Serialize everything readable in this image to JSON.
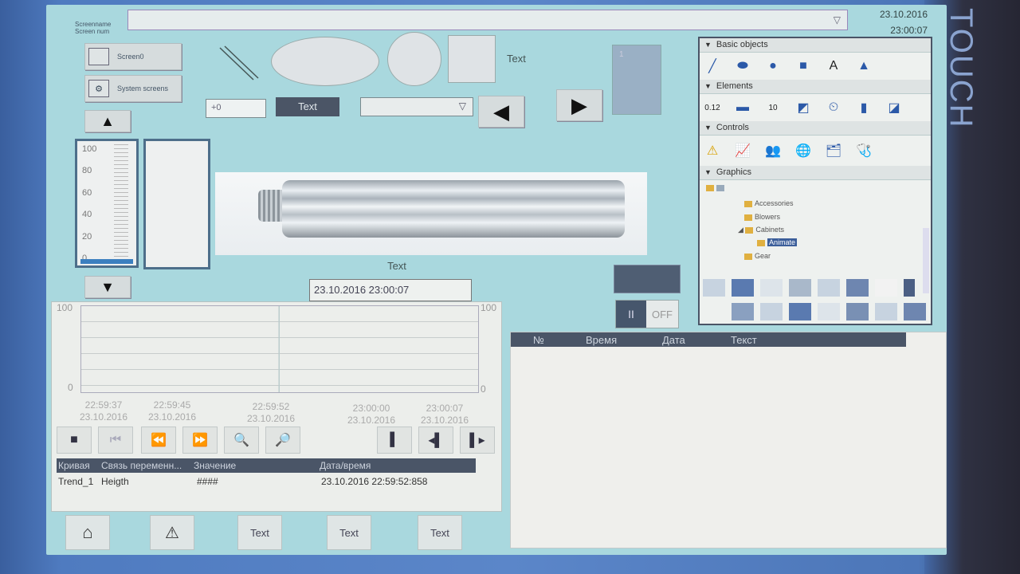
{
  "header": {
    "label_line1": "Screenname",
    "label_line2": "Screen num",
    "date": "23.10.2016",
    "time": "23:00:07"
  },
  "brand": "TOUCH",
  "screen_buttons": [
    {
      "label": "Screen0",
      "icon": "screen-icon"
    },
    {
      "label": "System screens",
      "icon": "system-icon"
    }
  ],
  "shapes": {
    "text_label": "Text"
  },
  "io_field": {
    "value": "+0"
  },
  "text_button": {
    "label": "Text"
  },
  "slider": {
    "value": "1"
  },
  "gauge": {
    "ticks": [
      "100",
      "80",
      "60",
      "40",
      "20",
      "0"
    ],
    "level": 0
  },
  "image_caption": "Text",
  "date_time_field": "23.10.2016 23:00:07",
  "toggle": {
    "on_label": "II",
    "off_label": "OFF"
  },
  "trend": {
    "y_left_max": "100",
    "y_left_min": "0",
    "y_right_max": "100",
    "y_right_min": "0",
    "x_ticks": [
      {
        "time": "22:59:37",
        "date": "23.10.2016"
      },
      {
        "time": "22:59:45",
        "date": "23.10.2016"
      },
      {
        "time": "22:59:52",
        "date": "23.10.2016"
      },
      {
        "time": "23:00:00",
        "date": "23.10.2016"
      },
      {
        "time": "23:00:07",
        "date": "23.10.2016"
      }
    ],
    "table_headers": [
      "Кривая",
      "Связь переменн...",
      "Значение",
      "Дата/время"
    ],
    "rows": [
      {
        "curve": "Trend_1",
        "tag": "Heigth",
        "value": "####",
        "datetime": "23.10.2016 22:59:52:858"
      }
    ]
  },
  "alarm": {
    "headers": [
      "№",
      "Время",
      "Дата",
      "Текст"
    ]
  },
  "library": {
    "sections": [
      "Basic objects",
      "Elements",
      "Controls",
      "Graphics"
    ],
    "element_labels": [
      "0.12",
      "10"
    ],
    "basic_text_icon": "A",
    "tree": [
      "Accessories",
      "Blowers",
      "Cabinets",
      "Animate",
      "Gear"
    ]
  },
  "bottom_nav": [
    "Text",
    "Text",
    "Text"
  ],
  "colors": {
    "screen_bg": "#a9d8de",
    "header_dark": "#4a5567",
    "accent_blue": "#3b5e9a"
  }
}
